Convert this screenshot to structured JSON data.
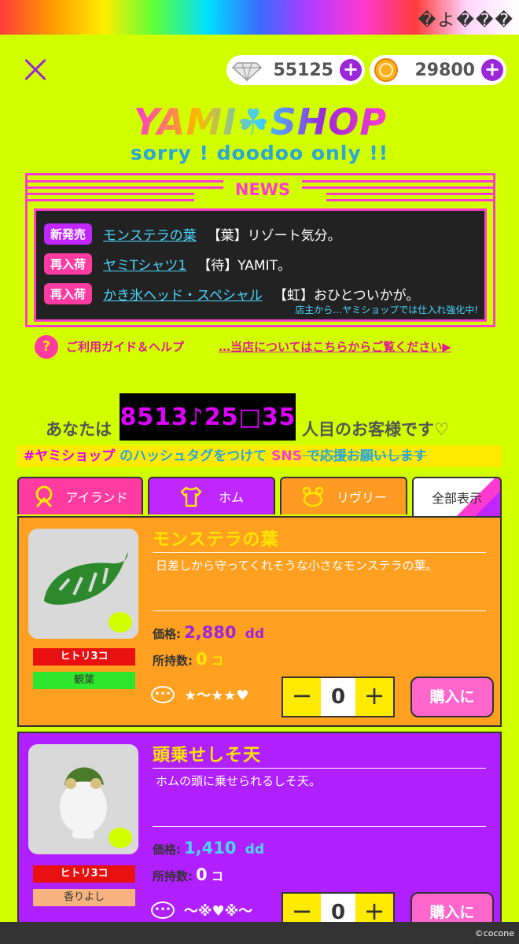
{
  "status": {
    "garbled_text": "�よ���"
  },
  "currency": {
    "diamonds": "55125",
    "coins": "29800",
    "plus": "+"
  },
  "header": {
    "title": "YAMI☘SHOP",
    "subtitle": "sorry ! doodoo only !!"
  },
  "news": {
    "title": "NEWS",
    "items": [
      {
        "badge": "新発売",
        "link": "モンステラの葉",
        "text": "【葉】リゾート気分。"
      },
      {
        "badge": "再入荷",
        "link": "ヤミTシャツ1",
        "text": "【待】YAMIT。"
      },
      {
        "badge": "再入荷",
        "link": "かき氷ヘッド・スペシャル",
        "text": "【虹】おひとついかが。"
      }
    ],
    "footer": "店主から…ヤミショップでは仕入れ強化中!"
  },
  "help": {
    "icon": "?",
    "label": "ご利用ガイド＆ヘルプ",
    "store_link": "…当店についてはこちらからご覧ください▶"
  },
  "visitor": {
    "prefix": "あなたは",
    "counter": [
      "8",
      "5",
      "1",
      "3",
      "♪",
      "2",
      "5",
      "□",
      "3",
      "5"
    ],
    "suffix": "人目のお客様です♡"
  },
  "hashtag": {
    "tag": "#ヤミショップ",
    "middle": " のハッシュタグをつけて ",
    "sns": "SNS",
    "struck": " で応援お願いします"
  },
  "tabs": [
    {
      "label": "アイランド",
      "icon": "island-icon",
      "color": "#ff3aa0"
    },
    {
      "label": "ホム",
      "icon": "shirt-icon",
      "color": "#c026ff"
    },
    {
      "label": "リヴリー",
      "icon": "crown-icon",
      "color": "#ff9a22"
    },
    {
      "label": "全部表示",
      "icon": "",
      "color": "#ffffff"
    }
  ],
  "products": [
    {
      "name": "モンステラの葉",
      "desc": "日差しから守ってくれそうな小さなモンステラの葉。",
      "price_label": "価格:",
      "price": "2,880",
      "unit": "dd",
      "own_label": "所持数:",
      "own": "0",
      "own_unit": "コ",
      "tag1": "ヒトリ3コ",
      "tag2": "観葉",
      "rating": "★〜★★♥",
      "qty": "0",
      "minus": "−",
      "plus": "+",
      "buy": "購入に",
      "bg": "#ffa020",
      "price_color": "#9b27d9",
      "tag2_bg": "#2ee62e"
    },
    {
      "name": "頭乗せしそ天",
      "desc": "ホムの頭に乗せられるしそ天。",
      "price_label": "価格:",
      "price": "1,410",
      "unit": "dd",
      "own_label": "所持数:",
      "own": "0",
      "own_unit": "コ",
      "tag1": "ヒトリ3コ",
      "tag2": "香りよし",
      "rating": "〜※♥※〜",
      "qty": "0",
      "minus": "−",
      "plus": "+",
      "buy": "購入に",
      "bg": "#b020ff",
      "price_color": "#4ad7ff",
      "tag2_bg": "#f6b37f"
    }
  ],
  "footer": {
    "copyright": "©cocone"
  }
}
